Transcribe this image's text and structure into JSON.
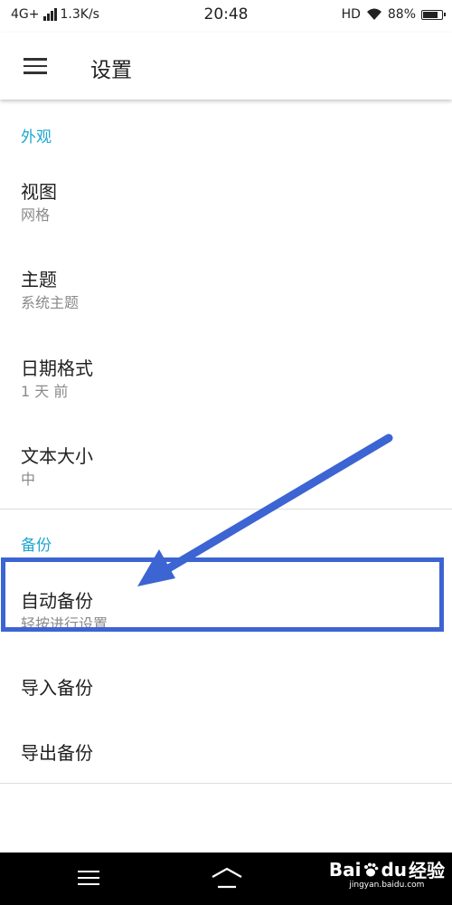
{
  "status_bar": {
    "network": "4G+",
    "speed": "1.3K/s",
    "time": "20:48",
    "hd": "HD",
    "battery_text": "88%",
    "battery_level": 0.88
  },
  "toolbar": {
    "title": "设置",
    "menu_icon": "hamburger-menu-icon"
  },
  "sections": {
    "appearance": {
      "header": "外观",
      "items": [
        {
          "title": "视图",
          "summary": "网格"
        },
        {
          "title": "主题",
          "summary": "系统主题"
        },
        {
          "title": "日期格式",
          "summary": "1 天 前"
        },
        {
          "title": "文本大小",
          "summary": "中"
        }
      ]
    },
    "backup": {
      "header": "备份",
      "items": [
        {
          "title": "自动备份",
          "summary": "轻按进行设置"
        },
        {
          "title": "导入备份"
        },
        {
          "title": "导出备份"
        }
      ]
    }
  },
  "nav_bar": {
    "icons": [
      "menu-icon",
      "home-icon"
    ]
  },
  "watermark": {
    "main_text_1": "Bai",
    "main_text_2": "du",
    "main_text_3": "经验",
    "sub_text": "jingyan.baidu.com"
  },
  "colors": {
    "accent": "#1ea7d0",
    "annotation": "#3c64d2",
    "summary_text": "#8a8a8a",
    "nav_background": "#000000"
  }
}
